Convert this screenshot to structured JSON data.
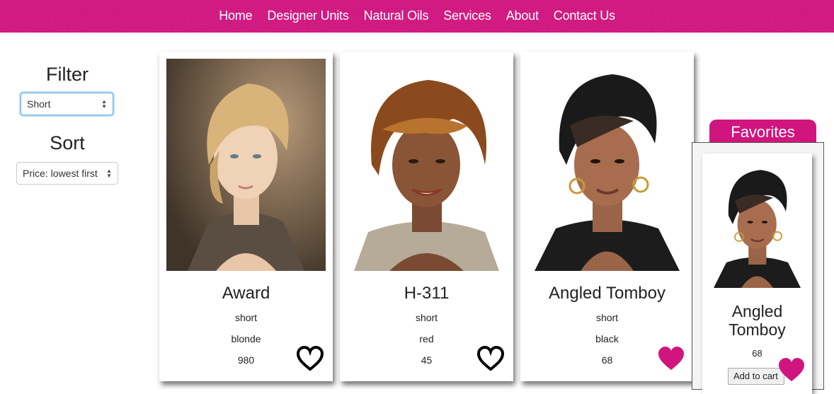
{
  "nav": [
    "Home",
    "Designer Units",
    "Natural Oils",
    "Services",
    "About",
    "Contact Us"
  ],
  "colors": {
    "brand": "#d0157f",
    "heart_filled": "#d0157f",
    "heart_outline": "#000000"
  },
  "sidebar": {
    "filter_heading": "Filter",
    "filter_value": "Short",
    "sort_heading": "Sort",
    "sort_value": "Price: lowest first"
  },
  "products": [
    {
      "name": "Award",
      "length": "short",
      "color": "blonde",
      "price": "980",
      "favorite": false
    },
    {
      "name": "H-311",
      "length": "short",
      "color": "red",
      "price": "45",
      "favorite": false
    },
    {
      "name": "Angled Tomboy",
      "length": "short",
      "color": "black",
      "price": "68",
      "favorite": true
    }
  ],
  "favorites": {
    "tab_label": "Favorites",
    "items": [
      {
        "name": "Angled Tomboy",
        "price": "68",
        "cart_label": "Add to cart",
        "favorite": true
      }
    ]
  }
}
